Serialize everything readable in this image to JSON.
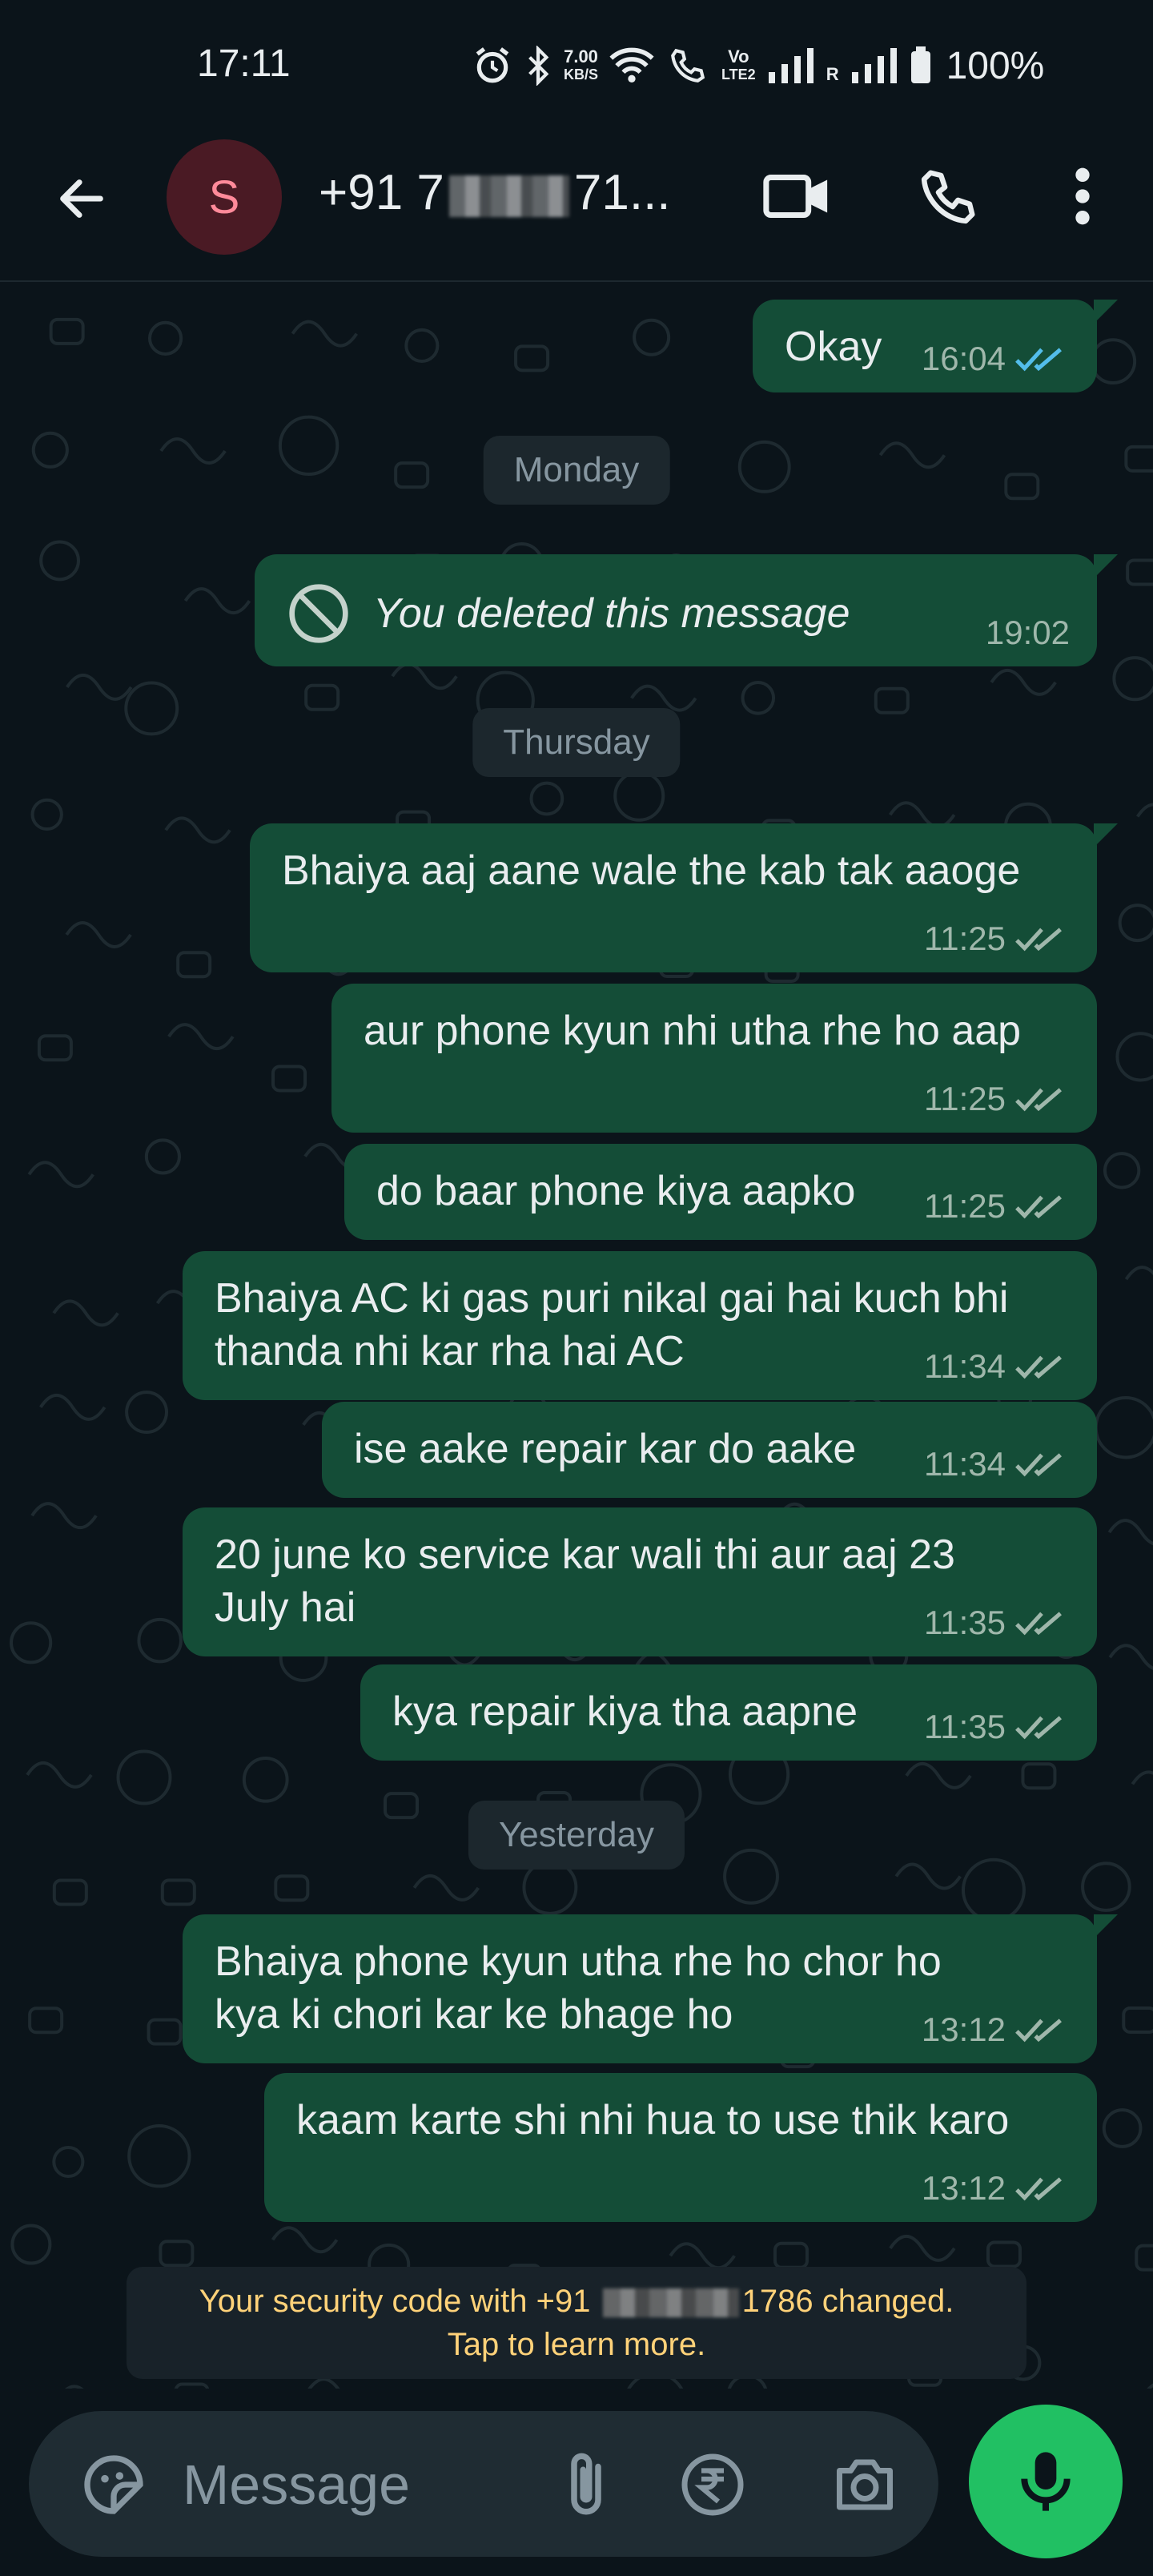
{
  "status_bar": {
    "time": "17:11",
    "speed_value": "7.00",
    "speed_unit": "KB/S",
    "volte": "Vo",
    "lte": "LTE2",
    "roaming": "R",
    "battery": "100%"
  },
  "header": {
    "avatar_letter": "S",
    "contact_prefix": "+91 7",
    "contact_suffix": "71..."
  },
  "messages": [
    {
      "text": "Okay",
      "time": "16:04",
      "status": "read"
    },
    {
      "day": "Monday"
    },
    {
      "text": "You deleted this message",
      "time": "19:02",
      "deleted": true
    },
    {
      "day": "Thursday"
    },
    {
      "text": "Bhaiya aaj aane wale the kab tak aaoge",
      "time": "11:25",
      "status": "delivered"
    },
    {
      "text": "aur phone kyun nhi utha rhe ho aap",
      "time": "11:25",
      "status": "delivered"
    },
    {
      "text": "do baar phone kiya aapko",
      "time": "11:25",
      "status": "delivered"
    },
    {
      "text": "Bhaiya AC ki gas puri nikal gai hai kuch bhi\nthanda nhi kar rha hai AC",
      "time": "11:34",
      "status": "delivered"
    },
    {
      "text": "ise aake repair kar do aake",
      "time": "11:34",
      "status": "delivered"
    },
    {
      "text": "20 june ko service kar wali thi aur aaj 23\nJuly hai",
      "time": "11:35",
      "status": "delivered"
    },
    {
      "text": "kya repair kiya tha aapne",
      "time": "11:35",
      "status": "delivered"
    },
    {
      "day": "Yesterday"
    },
    {
      "text": "Bhaiya phone kyun utha rhe ho chor ho\nkya ki chori kar ke bhage ho",
      "time": "13:12",
      "status": "delivered"
    },
    {
      "text": "kaam karte shi nhi hua to use thik karo",
      "time": "13:12",
      "status": "delivered"
    }
  ],
  "security": {
    "line1_prefix": "Your security code with +91",
    "line1_suffix": "1786 changed.",
    "line2": "Tap to learn more."
  },
  "input": {
    "placeholder": "Message"
  },
  "colors": {
    "background": "#0b141a",
    "outgoing_bubble": "#144d37",
    "read_ticks": "#53bdeb",
    "mic_button": "#21c063",
    "security_text": "#ffd279"
  },
  "icons": [
    "back-arrow-icon",
    "video-call-icon",
    "phone-icon",
    "more-options-icon",
    "sticker-icon",
    "attach-icon",
    "rupee-icon",
    "camera-icon",
    "mic-icon",
    "deleted-icon",
    "double-tick-icon"
  ]
}
